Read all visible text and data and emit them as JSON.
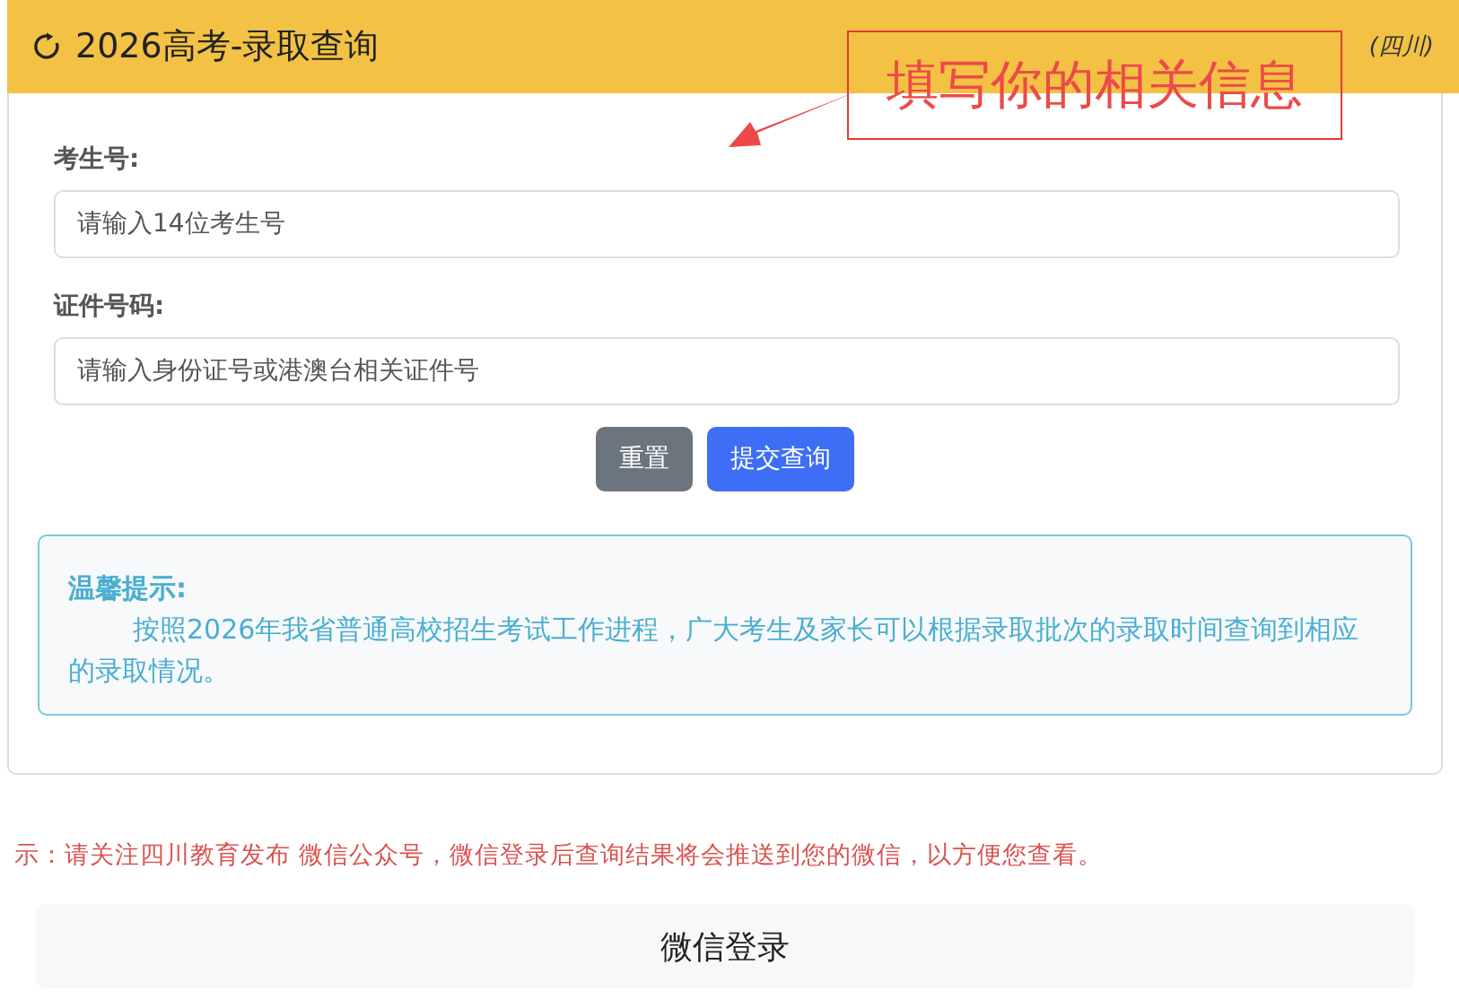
{
  "header": {
    "title": "2026高考-录取查询",
    "region": "(四川)"
  },
  "annotation": {
    "text": "填写你的相关信息"
  },
  "form": {
    "fields": [
      {
        "label": "考生号:",
        "placeholder": "请输入14位考生号"
      },
      {
        "label": "证件号码:",
        "placeholder": "请输入身份证号或港澳台相关证件号"
      }
    ],
    "buttons": [
      {
        "label": "重置",
        "kind": "secondary"
      },
      {
        "label": "提交查询",
        "kind": "primary"
      }
    ]
  },
  "tip": {
    "title": "温馨提示:",
    "text": "按照2026年我省普通高校招生考试工作进程，广大考生及家长可以根据录取批次的录取时间查询到相应的录取情况。"
  },
  "notice": "示：请关注四川教育发布 微信公众号，微信登录后查询结果将会推送到您的微信，以方便您查看。",
  "login_button": "微信登录"
}
